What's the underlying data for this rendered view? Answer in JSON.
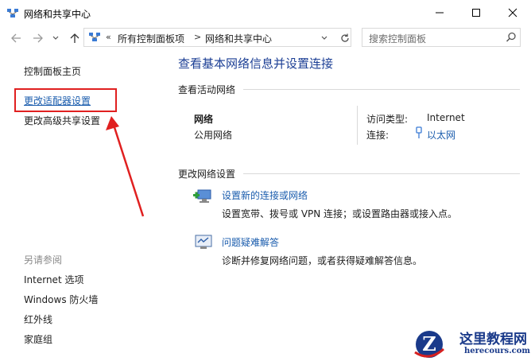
{
  "window": {
    "title": "网络和共享中心"
  },
  "addressbar": {
    "overflow_chevron": "«",
    "crumbs": [
      "所有控制面板项",
      "网络和共享中心"
    ],
    "separator": ">",
    "search_placeholder": "搜索控制面板"
  },
  "left_pane": {
    "home": "控制面板主页",
    "change_adapter": "更改适配器设置",
    "change_sharing": "更改高级共享设置",
    "see_also": "另请参阅",
    "see_also_items": [
      "Internet 选项",
      "Windows 防火墙",
      "红外线",
      "家庭组"
    ]
  },
  "main": {
    "title": "查看基本网络信息并设置连接",
    "active_header": "查看活动网络",
    "network_name": "网络",
    "network_type": "公用网络",
    "access_type_label": "访问类型:",
    "access_type_value": "Internet",
    "connections_label": "连接:",
    "connections_value": "以太网",
    "change_header": "更改网络设置",
    "items": [
      {
        "link": "设置新的连接或网络",
        "desc": "设置宽带、拨号或 VPN 连接；或设置路由器或接入点。"
      },
      {
        "link": "问题疑难解答",
        "desc": "诊断并修复网络问题，或者获得疑难解答信息。"
      }
    ]
  },
  "watermark": {
    "text": "这里教程网",
    "url": "herecours.com"
  },
  "colors": {
    "link": "#1a5cad",
    "title": "#1c3f95",
    "annotation": "#e02020"
  }
}
